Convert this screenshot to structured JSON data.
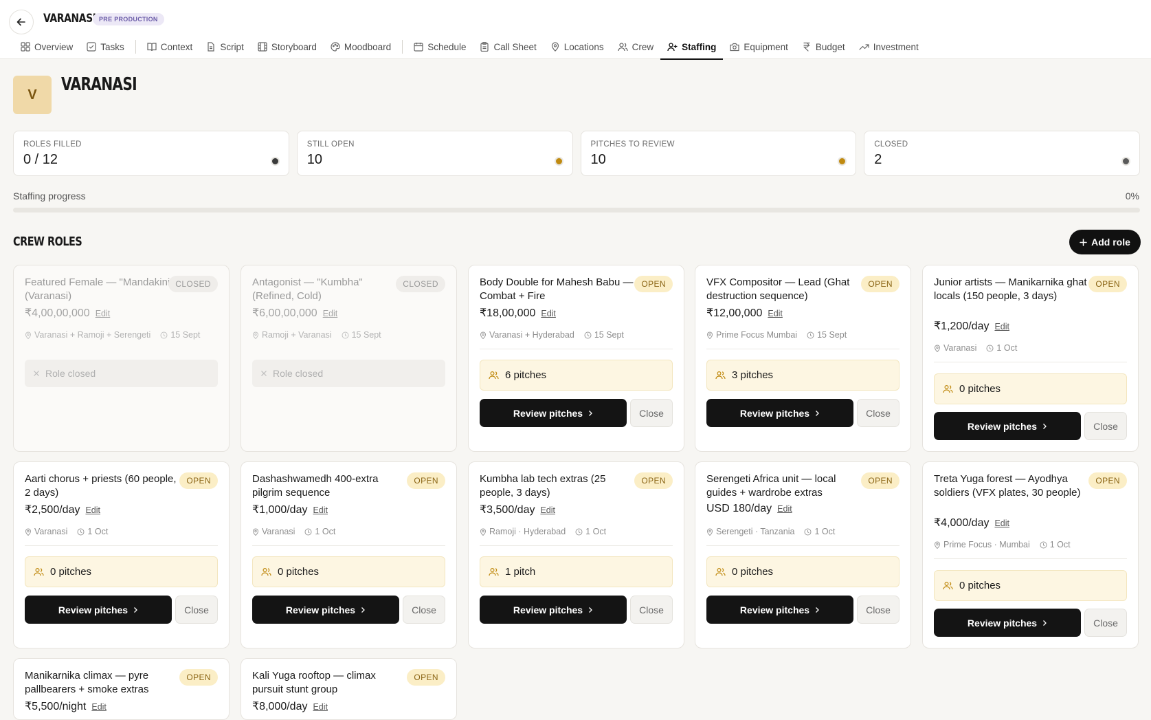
{
  "header": {
    "project_name": "VARANASI",
    "phase_badge": "PRE PRODUCTION",
    "tabs": [
      {
        "label": "Overview",
        "icon": "grid-icon"
      },
      {
        "label": "Tasks",
        "icon": "check-square-icon"
      },
      {
        "label": "Context",
        "icon": "book-icon"
      },
      {
        "label": "Script",
        "icon": "document-icon"
      },
      {
        "label": "Storyboard",
        "icon": "film-icon"
      },
      {
        "label": "Moodboard",
        "icon": "palette-icon"
      },
      {
        "label": "Schedule",
        "icon": "calendar-icon"
      },
      {
        "label": "Call Sheet",
        "icon": "clipboard-icon"
      },
      {
        "label": "Locations",
        "icon": "map-pin-icon"
      },
      {
        "label": "Crew",
        "icon": "users-icon"
      },
      {
        "label": "Staffing",
        "icon": "user-plus-icon"
      },
      {
        "label": "Equipment",
        "icon": "camera-icon"
      },
      {
        "label": "Budget",
        "icon": "rupee-icon"
      },
      {
        "label": "Investment",
        "icon": "trending-up-icon"
      }
    ],
    "active_tab": "Staffing"
  },
  "project": {
    "avatar_letter": "V",
    "title": "VARANASI"
  },
  "stats": [
    {
      "label": "ROLES FILLED",
      "value": "0 / 12",
      "dot_color": "#3a3a3a"
    },
    {
      "label": "STILL OPEN",
      "value": "10",
      "dot_color": "#c08a10"
    },
    {
      "label": "PITCHES TO REVIEW",
      "value": "10",
      "dot_color": "#c08a10"
    },
    {
      "label": "CLOSED",
      "value": "2",
      "dot_color": "#5a5a5a"
    }
  ],
  "progress": {
    "label": "Staffing progress",
    "percent_text": "0%",
    "fraction": 0
  },
  "section": {
    "title": "CREW ROLES",
    "add_role_label": "Add role"
  },
  "labels": {
    "edit": "Edit",
    "review_pitches": "Review pitches",
    "close": "Close",
    "role_closed": "Role closed"
  },
  "roles": [
    {
      "title": "Featured Female — \"Mandakini\" (Varanasi)",
      "status": "CLOSED",
      "price": "₹4,00,00,000",
      "location": "Varanasi + Ramoji + Serengeti",
      "date": "15 Sept"
    },
    {
      "title": "Antagonist — \"Kumbha\" (Refined, Cold)",
      "status": "CLOSED",
      "price": "₹6,00,00,000",
      "location": "Ramoji + Varanasi",
      "date": "15 Sept"
    },
    {
      "title": "Body Double for Mahesh Babu — Combat + Fire",
      "status": "OPEN",
      "price": "₹18,00,000",
      "location": "Varanasi + Hyderabad",
      "date": "15 Sept",
      "pitches": "6 pitches"
    },
    {
      "title": "VFX Compositor — Lead (Ghat destruction sequence)",
      "status": "OPEN",
      "price": "₹12,00,000",
      "location": "Prime Focus Mumbai",
      "date": "15 Sept",
      "pitches": "3 pitches"
    },
    {
      "title": "Junior artists — Manikarnika ghat locals (150 people, 3 days)",
      "status": "OPEN",
      "price": "₹1,200/day",
      "location": "Varanasi",
      "date": "1 Oct",
      "pitches": "0 pitches"
    },
    {
      "title": "Aarti chorus + priests (60 people, 2 days)",
      "status": "OPEN",
      "price": "₹2,500/day",
      "location": "Varanasi",
      "date": "1 Oct",
      "pitches": "0 pitches"
    },
    {
      "title": "Dashashwamedh 400-extra pilgrim sequence",
      "status": "OPEN",
      "price": "₹1,000/day",
      "location": "Varanasi",
      "date": "1 Oct",
      "pitches": "0 pitches"
    },
    {
      "title": "Kumbha lab tech extras (25 people, 3 days)",
      "status": "OPEN",
      "price": "₹3,500/day",
      "location": "Ramoji · Hyderabad",
      "date": "1 Oct",
      "pitches": "1 pitch"
    },
    {
      "title": "Serengeti Africa unit — local guides + wardrobe extras",
      "status": "OPEN",
      "price": "USD 180/day",
      "location": "Serengeti · Tanzania",
      "date": "1 Oct",
      "pitches": "0 pitches"
    },
    {
      "title": "Treta Yuga forest — Ayodhya soldiers (VFX plates, 30 people)",
      "status": "OPEN",
      "price": "₹4,000/day",
      "location": "Prime Focus · Mumbai",
      "date": "1 Oct",
      "pitches": "0 pitches"
    },
    {
      "title": "Manikarnika climax — pyre pallbearers + smoke extras",
      "status": "OPEN",
      "price": "₹5,500/night"
    },
    {
      "title": "Kali Yuga rooftop — climax pursuit stunt group",
      "status": "OPEN",
      "price": "₹8,000/day"
    }
  ]
}
